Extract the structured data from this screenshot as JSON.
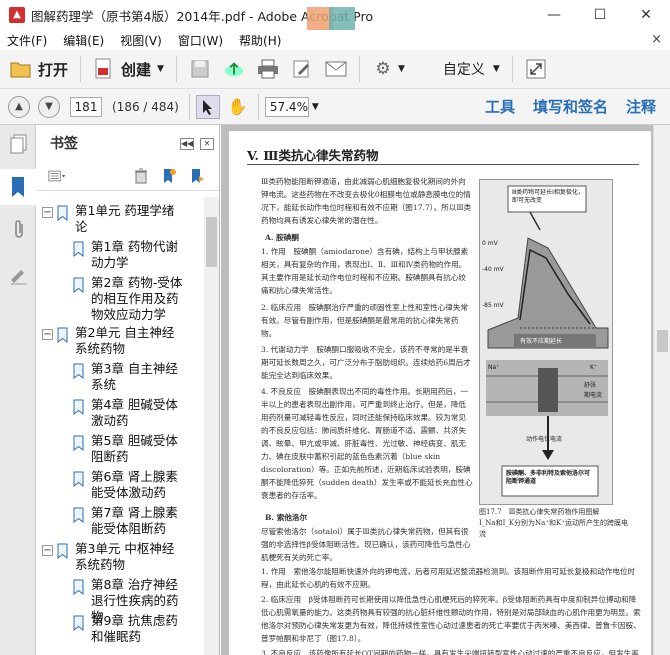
{
  "window": {
    "title": "图解药理学（原书第4版）2014年.pdf - Adobe Acrobat Pro",
    "minimize": "—",
    "maximize": "☐",
    "close": "✕"
  },
  "menu": {
    "items": [
      "文件(F)",
      "编辑(E)",
      "视图(V)",
      "窗口(W)",
      "帮助(H)"
    ],
    "close_doc": "×"
  },
  "toolbar": {
    "open_label": "打开",
    "create_label": "创建",
    "customize_label": "自定义"
  },
  "nav": {
    "current_page": "181",
    "page_total": "(186 / 484)",
    "zoom": "57.4%",
    "tools_label": "工具",
    "sign_label": "填写和签名",
    "comment_label": "注释"
  },
  "bookmarks": {
    "title": "书签",
    "items": [
      {
        "text": "第1单元 药理学绪论",
        "level": 0,
        "expanded": true
      },
      {
        "text": "第1章 药物代谢动力学",
        "level": 1
      },
      {
        "text": "第2章 药物-受体的相互作用及药物效应动力学",
        "level": 1
      },
      {
        "text": "第2单元 自主神经系统药物",
        "level": 0,
        "expanded": true
      },
      {
        "text": "第3章 自主神经系统",
        "level": 1
      },
      {
        "text": "第4章 胆碱受体激动药",
        "level": 1
      },
      {
        "text": "第5章 胆碱受体阻断药",
        "level": 1
      },
      {
        "text": "第6章 肾上腺素能受体激动药",
        "level": 1
      },
      {
        "text": "第7章 肾上腺素能受体阻断药",
        "level": 1
      },
      {
        "text": "第3单元 中枢神经系统药物",
        "level": 0,
        "expanded": true
      },
      {
        "text": "第8章 治疗神经退行性疾病的药物",
        "level": 1
      },
      {
        "text": "第9章 抗焦虑药和催眠药",
        "level": 1
      }
    ]
  },
  "page": {
    "heading": "V. Ⅲ类抗心律失常药物",
    "intro": "Ⅲ类药物能阻断钾通道，由此减弱心肌细胞复极化期间的外向钾电流。这些药物在不改变去极化0相膜电位或静息膜电位的情况下，能延长动作电位时程和有效不应期（图17.7）。所以Ⅲ类药物均具有诱发心律失常的潜在性。",
    "sub_a": "A. 胺碘酮",
    "a1": "1. 作用　胺碘酮（amiodarone）含有碘，结构上与甲状腺素相关，具有复杂的作用，表现出Ⅰ、Ⅱ、Ⅲ和Ⅳ类药物的作用。其主要作用是延长动作电位时程和不应期。胺碘酮具有抗心绞痛和抗心律失常活性。",
    "a2": "2. 临床应用　胺碘酮治疗严重的顽固性室上性和室性心律失常有效。尽管有副作用，但是胺碘酮是最常用的抗心律失常药物。",
    "a3": "3. 代谢动力学　胺碘酮口服吸收不完全，该药不寻常的是半衰期可延长数周之久，可广泛分布于脂肪组织。连续给药6周后才能完全达到临床效果。",
    "a4": "4. 不良反应　胺碘酮表现出不同的毒性作用。长期用药后，一半以上的患者表现出副作用，可严重到终止治疗。但是，降低用药剂量可减轻毒性反应，同时还能保持临床效果。较为常见的不良反应包括：肺间质纤维化、胃肠道不适、震颤、共济失调、眩晕、甲亢或甲减、肝脏毒性、光过敏、神经病变、肌无力、碘在皮肤中蓄积引起的蓝色色素沉着（blue skin discoloration）等。正如先前所述，近期临床试验表明，胺碘酮不能降低猝死（sudden death）发生率或不能延长充血性心衰患者的存活率。",
    "sub_b": "B. 索他洛尔",
    "b0": "尽管索他洛尔（sotalol）属于Ⅲ类抗心律失常药物，但其有很强的非选择性β受体阻断活性。现已确认，该药可降低与急性心肌梗死有关的死亡率。",
    "b1": "1. 作用　索他洛尔能阻断快速外向的钾电流，后者可用延迟整流器检测到。该阻断作用可延长复极和动作电位时程，由此延长心肌的有效不应期。",
    "b2": "2. 临床应用　β受体阻断药可长期使用以降低急性心肌梗死后的猝死率。β受体阻断药具有中度抑制异位搏动和降低心肌需氧量的能力。这类药物具有较强的抗心脏纤维性颤动的作用，特别是对局部缺血的心肌作用更为明显。索他洛尔对预防心律失常发更为有效，降低持续性室性心动过速患者的死亡率要优于丙米嗪、美西律、普鲁卡因胺、普罗帕酮和非尼丁（图17.8）。",
    "b3": "3. 不良反应　该药像所有延长QT间期的药物一样，具有发生尖端扭转型室性心动过速的严重不良反应，但发生率较低。",
    "figure": {
      "top_note": "Ⅲ类药物可延长Ⅰ相复极化，即可无改变",
      "zero_mv": "0 mV",
      "minus40": "-40 mV",
      "minus85": "-85 mV",
      "prolong": "有效不应期延长",
      "caption_a": "图17.7　Ⅲ类抗心律失常药物作用图解",
      "caption_b": "I_Na和I_K分别为Na⁺和K⁺运动所产生的跨膜电流",
      "bottom_note": "胺碘酮、多非利特及索他洛尔可阻断钾通道",
      "channel_labels": [
        "动作电位电流",
        "Na⁺",
        "K⁺",
        "舒张",
        "期电流"
      ]
    }
  }
}
